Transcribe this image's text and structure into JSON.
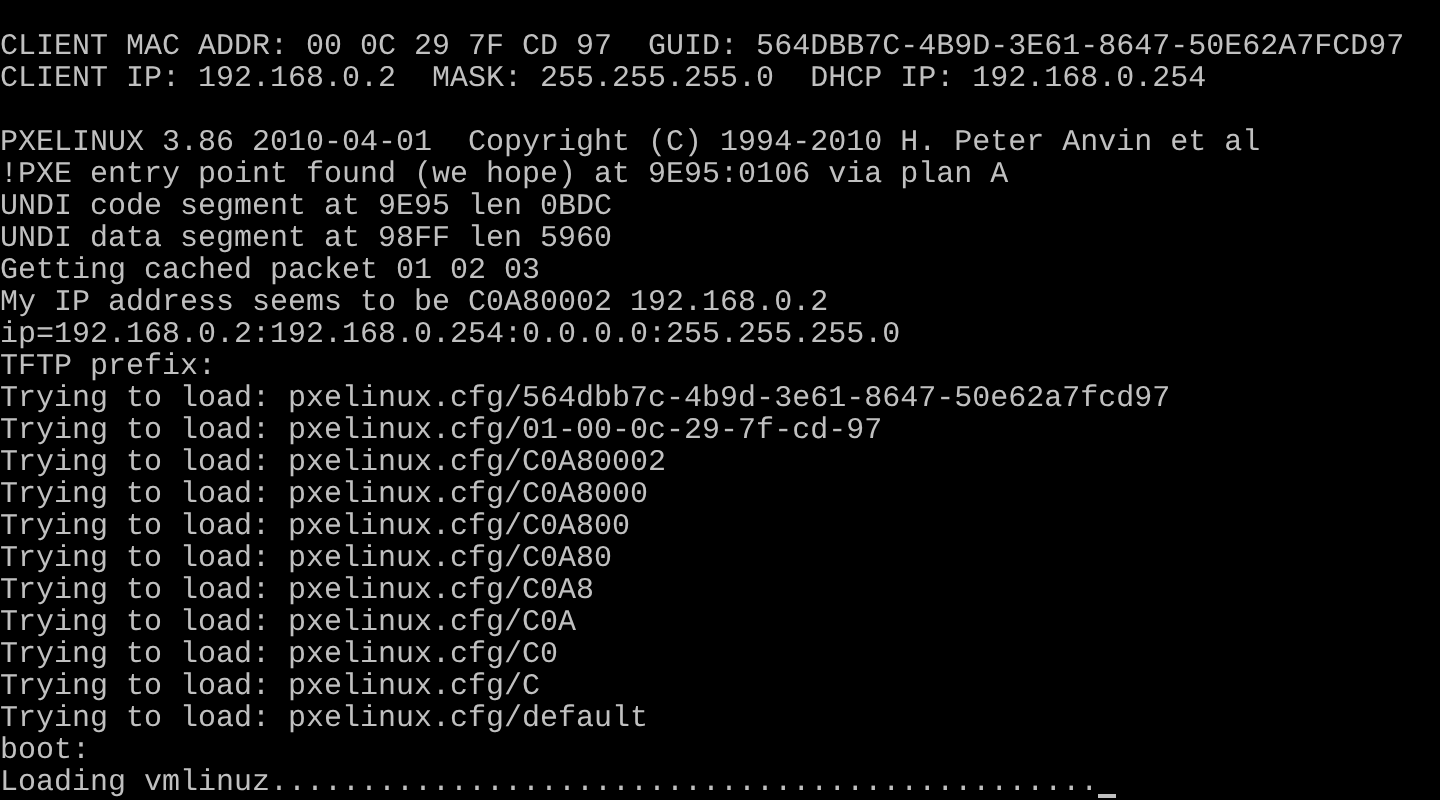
{
  "console": {
    "header_lines": [
      "CLIENT MAC ADDR: 00 0C 29 7F CD 97  GUID: 564DBB7C-4B9D-3E61-8647-50E62A7FCD97",
      "CLIENT IP: 192.168.0.2  MASK: 255.255.255.0  DHCP IP: 192.168.0.254"
    ],
    "boot_lines": [
      "PXELINUX 3.86 2010-04-01  Copyright (C) 1994-2010 H. Peter Anvin et al",
      "!PXE entry point found (we hope) at 9E95:0106 via plan A",
      "UNDI code segment at 9E95 len 0BDC",
      "UNDI data segment at 98FF len 5960",
      "Getting cached packet 01 02 03",
      "My IP address seems to be C0A80002 192.168.0.2",
      "ip=192.168.0.2:192.168.0.254:0.0.0.0:255.255.255.0",
      "TFTP prefix:",
      "Trying to load: pxelinux.cfg/564dbb7c-4b9d-3e61-8647-50e62a7fcd97",
      "Trying to load: pxelinux.cfg/01-00-0c-29-7f-cd-97",
      "Trying to load: pxelinux.cfg/C0A80002",
      "Trying to load: pxelinux.cfg/C0A8000",
      "Trying to load: pxelinux.cfg/C0A800",
      "Trying to load: pxelinux.cfg/C0A80",
      "Trying to load: pxelinux.cfg/C0A8",
      "Trying to load: pxelinux.cfg/C0A",
      "Trying to load: pxelinux.cfg/C0",
      "Trying to load: pxelinux.cfg/C",
      "Trying to load: pxelinux.cfg/default",
      "boot:",
      "Loading vmlinuz.............................................."
    ]
  }
}
